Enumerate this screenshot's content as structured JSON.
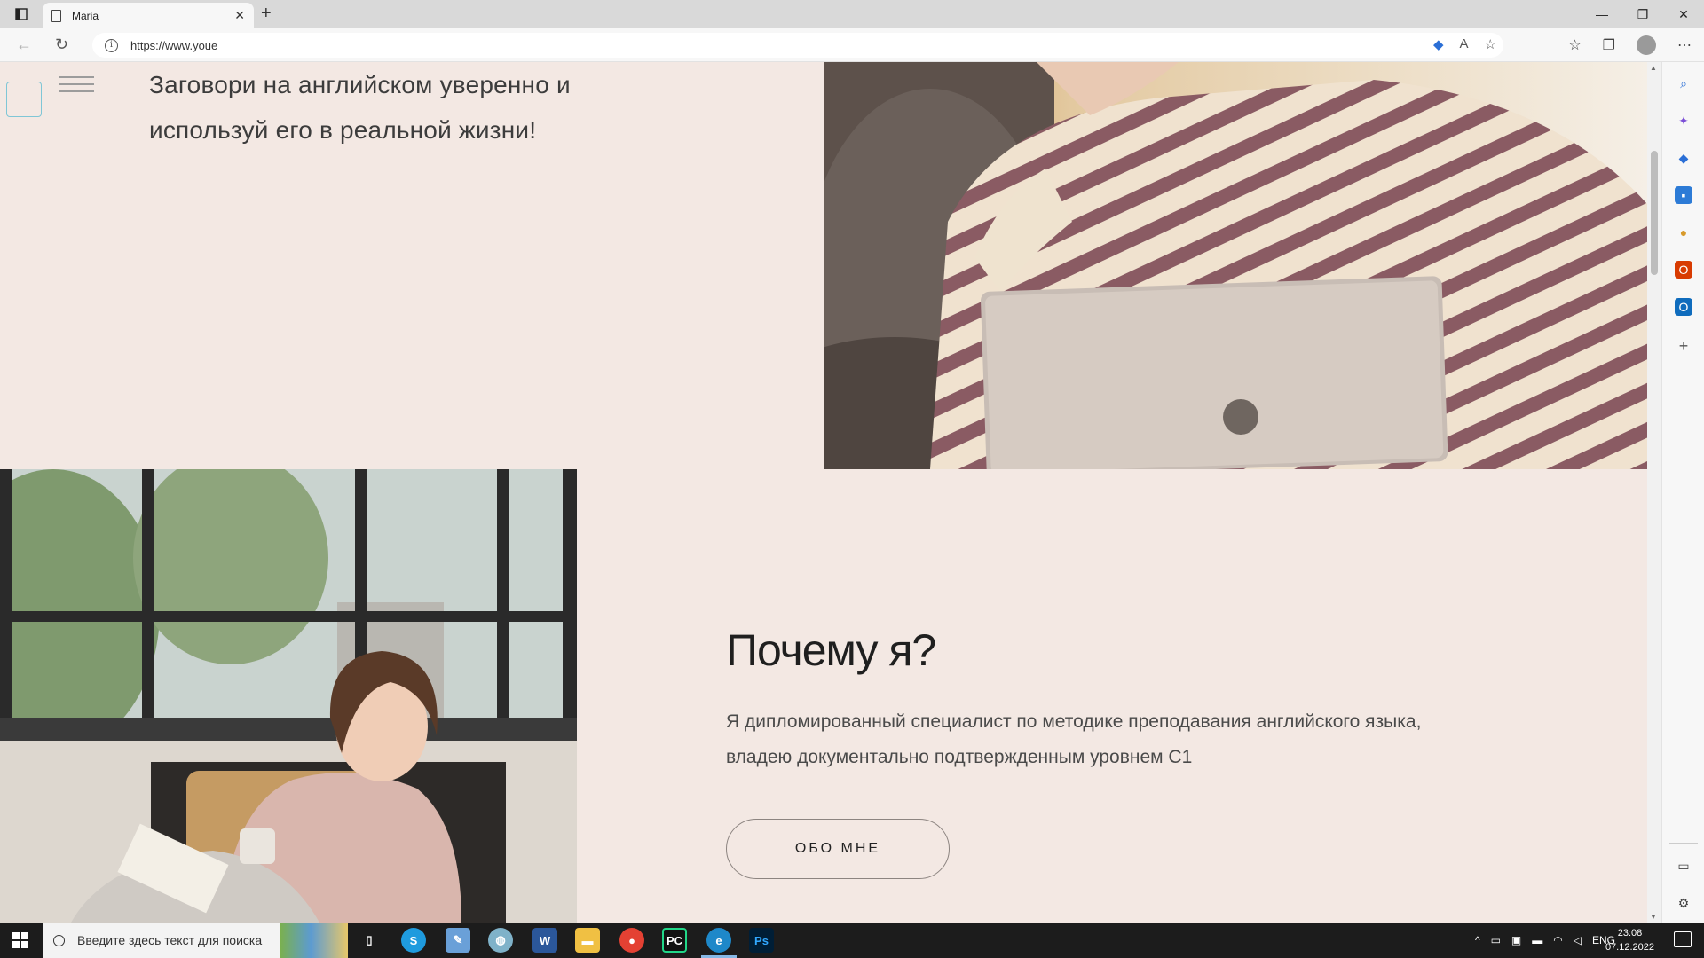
{
  "browser": {
    "tab_title": "Maria",
    "url": "https://www.youe",
    "new_tab_symbol": "+",
    "close_symbol": "✕"
  },
  "hero": {
    "tagline_line1": "Заговори на английском уверенно и",
    "tagline_line2": "используй его в реальной жизни!"
  },
  "why": {
    "title": "Почему я?",
    "text_line1": "Я дипломированный специалист по методике преподавания английского языка,",
    "text_line2": "владею документально подтвержденным уровнем C1",
    "button_label": "ОБО МНЕ"
  },
  "taskbar": {
    "search_placeholder": "Введите здесь текст для поиска",
    "language": "ENG",
    "time": "23:08",
    "date": "07.12.2022"
  },
  "icons": [
    "sidebar-toggle-icon",
    "doc-icon",
    "back-icon",
    "refresh-icon",
    "info-icon",
    "read-aloud-icon",
    "favorite-add-icon",
    "favorites-icon",
    "collections-icon",
    "profile-icon",
    "more-icon",
    "search-icon",
    "copilot-icon",
    "shopping-icon",
    "tools-icon",
    "games-icon",
    "office-icon",
    "outlook-icon",
    "add-icon",
    "split-screen-icon",
    "settings-icon",
    "windows-icon",
    "task-view-icon",
    "skype-icon",
    "notes-icon",
    "paint-icon",
    "word-icon",
    "explorer-icon",
    "chrome-icon",
    "pycharm-icon",
    "edge-icon",
    "photoshop-icon"
  ],
  "colors": {
    "page_bg": "#f3e8e3",
    "accent_box": "#7fc6d6",
    "title_text": "#1f1f1f"
  }
}
